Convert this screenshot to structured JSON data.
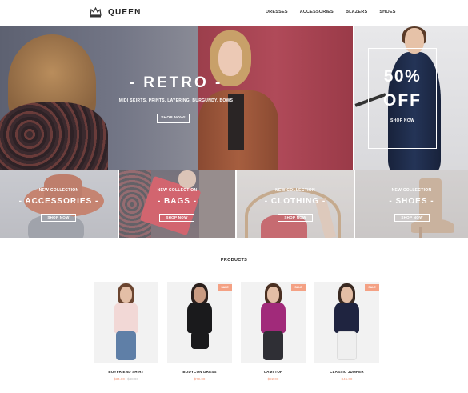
{
  "brand": {
    "name": "QUEEN",
    "logo_icon": "crown-icon"
  },
  "nav": [
    "DRESSES",
    "ACCESSORIES",
    "BLAZERS",
    "SHOES"
  ],
  "hero": {
    "title": "- RETRO -",
    "subtitle": "MIDI SKIRTS, PRINTS, LAYERING, BURGUNDY, BOWS",
    "button": "SHOP NOW!"
  },
  "sale": {
    "percent": "50%",
    "off": "OFF",
    "button": "SHOP NOW"
  },
  "categories": [
    {
      "tag": "NEW COLLECTION",
      "name": "- ACCESSORIES -",
      "button": "SHOP NOW"
    },
    {
      "tag": "NEW COLLECTION",
      "name": "- BAGS -",
      "button": "SHOP NOW"
    },
    {
      "tag": "NEW COLLECTION",
      "name": "- CLOTHING -",
      "button": "SHOP NOW"
    },
    {
      "tag": "NEW COLLECTION",
      "name": "- SHOES -",
      "button": "SHOP NOW"
    }
  ],
  "products_heading": "PRODUCTS",
  "products": [
    {
      "name": "BOYFRIEND SHIRT",
      "price": "$34.00",
      "old_price": "$48.00",
      "badge": ""
    },
    {
      "name": "BODYCON DRESS",
      "price": "$70.00",
      "old_price": "",
      "badge": "SALE"
    },
    {
      "name": "CAMI TOP",
      "price": "$22.00",
      "old_price": "",
      "badge": "SALE"
    },
    {
      "name": "CLASSIC JUMPER",
      "price": "$46.00",
      "old_price": "",
      "badge": "SALE"
    }
  ],
  "colors": {
    "accent": "#f39a7b",
    "badge": "#f4a184"
  }
}
